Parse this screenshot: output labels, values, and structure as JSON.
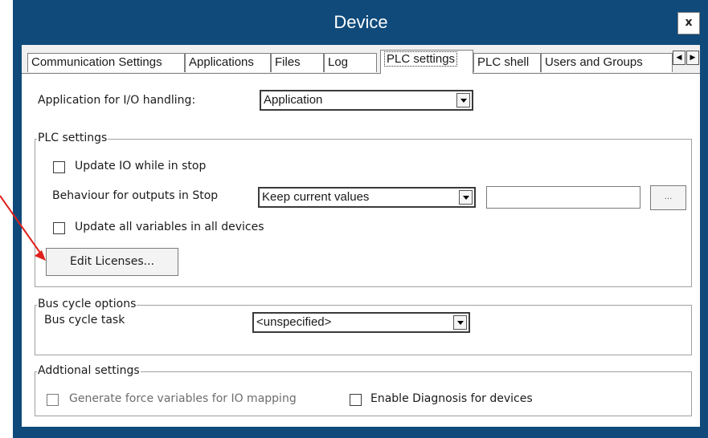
{
  "window": {
    "title": "Device",
    "close_label": "x"
  },
  "tabs": [
    {
      "label": "Communication Settings"
    },
    {
      "label": "Applications"
    },
    {
      "label": "Files"
    },
    {
      "label": "Log"
    },
    {
      "label": "PLC settings",
      "active": true
    },
    {
      "label": "PLC shell"
    },
    {
      "label": "Users and Groups"
    }
  ],
  "tab_scroll": {
    "left_icon": "◀",
    "right_icon": "▶"
  },
  "io_handling": {
    "label": "Application for I/O handling:",
    "value": "Application"
  },
  "plc_settings": {
    "title": "PLC settings",
    "update_io_label": "Update IO while in stop",
    "update_io_checked": false,
    "behaviour_label": "Behaviour for outputs in Stop",
    "behaviour_value": "Keep current values",
    "behaviour_text": "",
    "browse_label": "...",
    "update_all_label": "Update all variables in all devices",
    "update_all_checked": false,
    "edit_licenses_label": "Edit Licenses..."
  },
  "bus_cycle": {
    "title": "Bus cycle options",
    "task_label": "Bus cycle task",
    "task_value": "<unspecified>"
  },
  "additional": {
    "title": "Addtional settings",
    "force_vars_label": "Generate force variables for IO mapping",
    "force_vars_checked": false,
    "diagnosis_label": "Enable Diagnosis for devices",
    "diagnosis_checked": false
  },
  "colors": {
    "title_bar": "#0f4a7a",
    "annotation_arrow": "#e0201c"
  },
  "icons": {
    "annotation": "red-arrow-icon",
    "dropdown": "chevron-down-icon"
  }
}
